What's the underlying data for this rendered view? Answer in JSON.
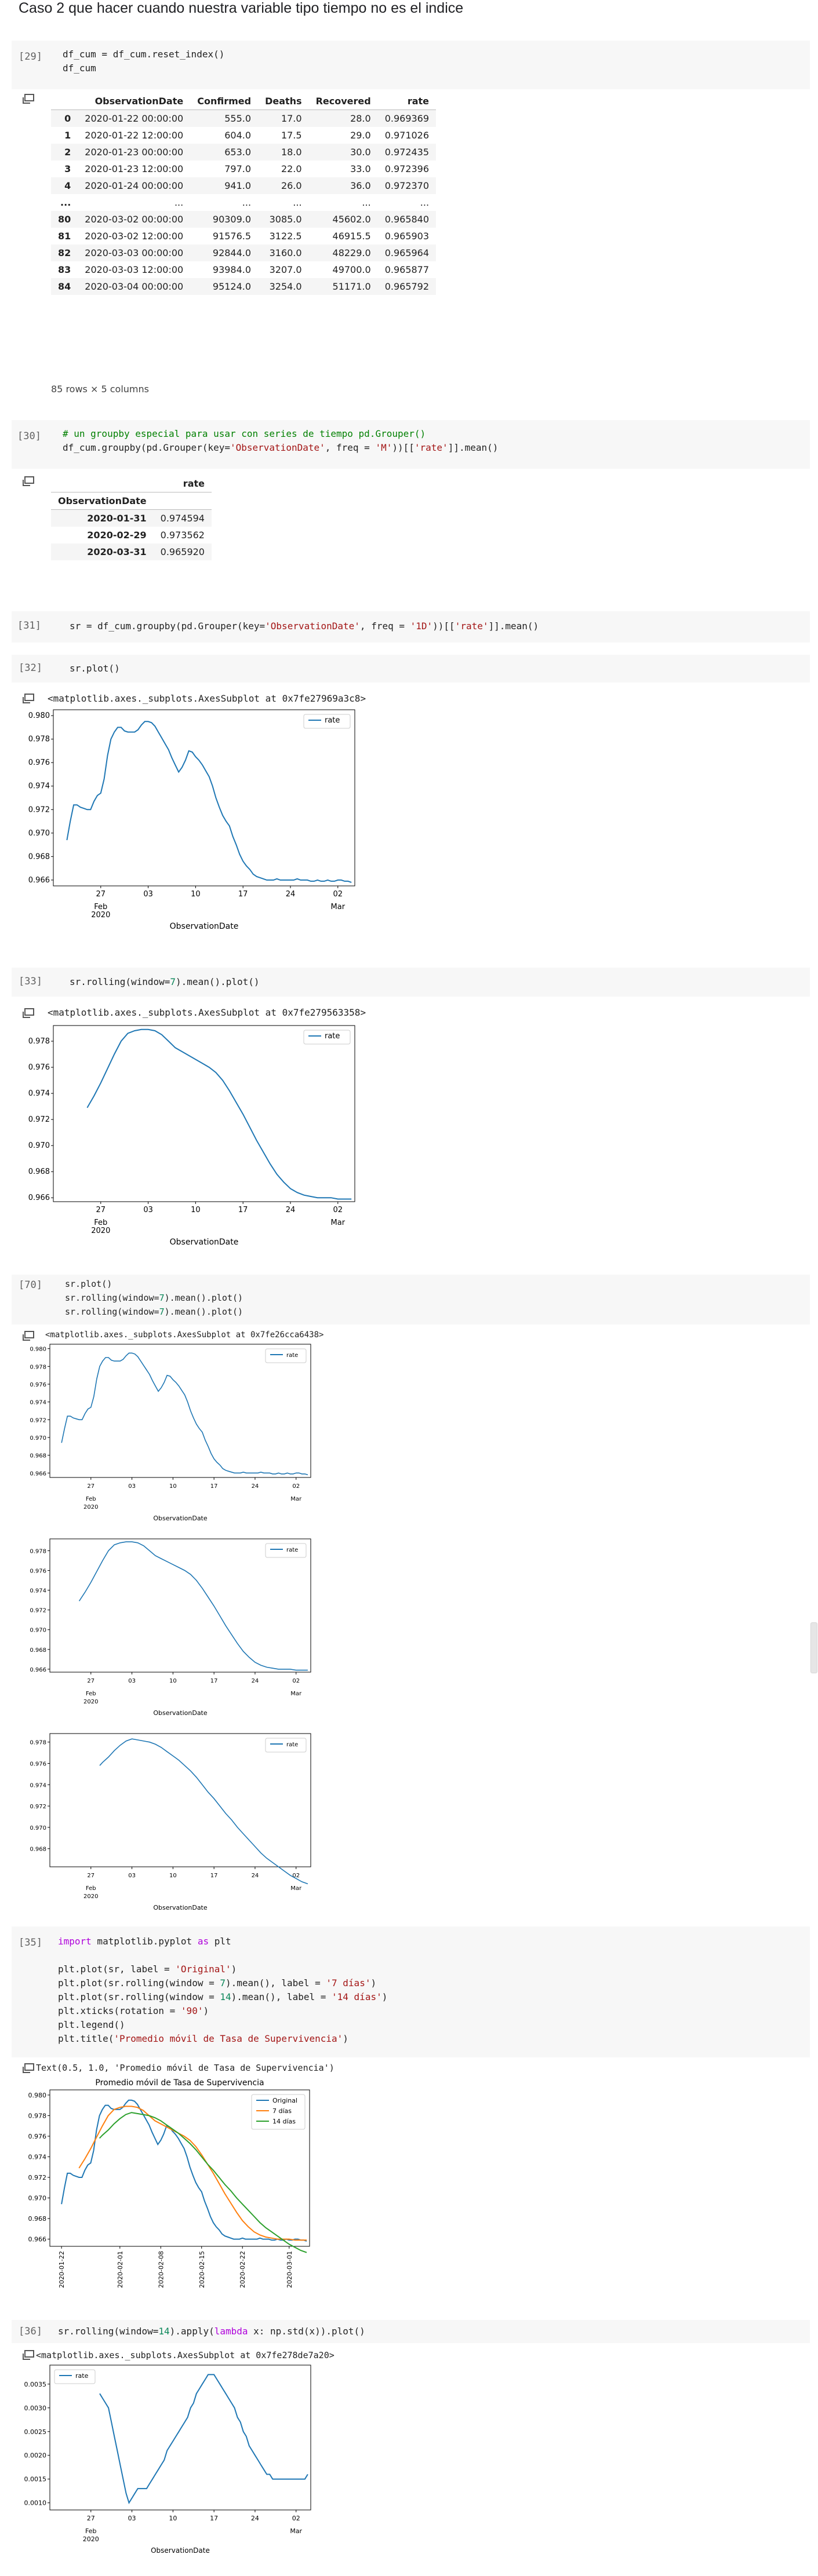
{
  "heading": "Caso 2 que hacer cuando nuestra variable tipo tiempo no es el indice",
  "cells": [
    {
      "prompt": "[29]",
      "code": [
        "df_cum = df_cum.reset_index()",
        "df_cum"
      ]
    },
    {
      "prompt": "[30]",
      "code_comment": "# un groupby especial para usar con series de tiempo pd.Grouper()",
      "code_pre": "df_cum.groupby(pd.Grouper(key=",
      "code_s1": "'ObservationDate'",
      "code_mid": ", freq = ",
      "code_s2": "'M'",
      "code_post": "))[[",
      "code_s3": "'rate'",
      "code_end": "]].mean()"
    },
    {
      "prompt": "[31]",
      "code_pre": "sr = df_cum.groupby(pd.Grouper(key=",
      "code_s1": "'ObservationDate'",
      "code_mid": ", freq = ",
      "code_s2": "'1D'",
      "code_post": "))[[",
      "code_s3": "'rate'",
      "code_end": "]].mean()"
    },
    {
      "prompt": "[32]",
      "code": "sr.plot()",
      "output": "<matplotlib.axes._subplots.AxesSubplot at 0x7fe27969a3c8>"
    },
    {
      "prompt": "[33]",
      "code_pre": "sr.rolling(window=",
      "code_num": "7",
      "code_end": ").mean().plot()",
      "output": "<matplotlib.axes._subplots.AxesSubplot at 0x7fe279563358>"
    },
    {
      "prompt": "[70]",
      "code_l1": "sr.plot()",
      "code_l2_pre": "sr.rolling(window=",
      "code_l2_num": "7",
      "code_l2_end": ").mean().plot()",
      "code_l3_pre": "sr.rolling(window=",
      "code_l3_num": "7",
      "code_l3_end": ").mean().plot()",
      "output": "<matplotlib.axes._subplots.AxesSubplot at 0x7fe26cca6438>"
    },
    {
      "prompt": "[35]",
      "output": "Text(0.5, 1.0, 'Promedio móvil de Tasa de Supervivencia')"
    },
    {
      "prompt": "[36]",
      "code_pre": "sr.rolling(window=",
      "code_num": "14",
      "code_mid": ").apply(",
      "code_kw": "lambda",
      "code_end": " x: np.std(x)).plot()",
      "output": "<matplotlib.axes._subplots.AxesSubplot at 0x7fe278de7a20>"
    }
  ],
  "cell35_lines": {
    "l1_kw1": "import",
    "l1_mid": " matplotlib.pyplot ",
    "l1_kw2": "as",
    "l1_end": " plt",
    "l2_pre": "plt.plot(sr, label = ",
    "l2_s": "'Original'",
    "l2_end": ")",
    "l3_pre": "plt.plot(sr.rolling(window = ",
    "l3_n": "7",
    "l3_mid": ").mean(), label = ",
    "l3_s": "'7 días'",
    "l3_end": ")",
    "l4_pre": "plt.plot(sr.rolling(window = ",
    "l4_n": "14",
    "l4_mid": ").mean(), label = ",
    "l4_s": "'14 días'",
    "l4_end": ")",
    "l5_pre": "plt.xticks(rotation = ",
    "l5_s": "'90'",
    "l5_end": ")",
    "l6": "plt.legend()",
    "l7_pre": "plt.title(",
    "l7_s": "'Promedio móvil de Tasa de Supervivencia'",
    "l7_end": ")"
  },
  "table1": {
    "columns": [
      "",
      "ObservationDate",
      "Confirmed",
      "Deaths",
      "Recovered",
      "rate"
    ],
    "rows": [
      [
        "0",
        "2020-01-22 00:00:00",
        "555.0",
        "17.0",
        "28.0",
        "0.969369"
      ],
      [
        "1",
        "2020-01-22 12:00:00",
        "604.0",
        "17.5",
        "29.0",
        "0.971026"
      ],
      [
        "2",
        "2020-01-23 00:00:00",
        "653.0",
        "18.0",
        "30.0",
        "0.972435"
      ],
      [
        "3",
        "2020-01-23 12:00:00",
        "797.0",
        "22.0",
        "33.0",
        "0.972396"
      ],
      [
        "4",
        "2020-01-24 00:00:00",
        "941.0",
        "26.0",
        "36.0",
        "0.972370"
      ],
      [
        "...",
        "...",
        "...",
        "...",
        "...",
        "..."
      ],
      [
        "80",
        "2020-03-02 00:00:00",
        "90309.0",
        "3085.0",
        "45602.0",
        "0.965840"
      ],
      [
        "81",
        "2020-03-02 12:00:00",
        "91576.5",
        "3122.5",
        "46915.5",
        "0.965903"
      ],
      [
        "82",
        "2020-03-03 00:00:00",
        "92844.0",
        "3160.0",
        "48229.0",
        "0.965964"
      ],
      [
        "83",
        "2020-03-03 12:00:00",
        "93984.0",
        "3207.0",
        "49700.0",
        "0.965877"
      ],
      [
        "84",
        "2020-03-04 00:00:00",
        "95124.0",
        "3254.0",
        "51171.0",
        "0.965792"
      ]
    ],
    "footer": "85 rows × 5 columns"
  },
  "table2": {
    "col": "rate",
    "index_name": "ObservationDate",
    "rows": [
      [
        "2020-01-31",
        "0.974594"
      ],
      [
        "2020-02-29",
        "0.973562"
      ],
      [
        "2020-03-31",
        "0.965920"
      ]
    ]
  },
  "chart_data": [
    {
      "id": "sr_plot",
      "type": "line",
      "xlabel": "ObservationDate",
      "ylabel": "",
      "xticks": [
        "27",
        "03",
        "10",
        "17",
        "24",
        "02"
      ],
      "xticks_sub": [
        "",
        "Feb\n2020",
        "",
        "",
        "",
        "Mar"
      ],
      "ylim": [
        0.9655,
        0.9805
      ],
      "yticks": [
        "0.966",
        "0.968",
        "0.970",
        "0.972",
        "0.974",
        "0.976",
        "0.978",
        "0.980"
      ],
      "series": [
        {
          "name": "rate",
          "color": "#1f77b4",
          "x": [
            0,
            0.5,
            1,
            1.5,
            2,
            2.5,
            3,
            3.5,
            4,
            4.5,
            5,
            5.5,
            6,
            6.5,
            7,
            7.5,
            8,
            8.5,
            9,
            9.5,
            10,
            10.5,
            11,
            11.5,
            12,
            12.5,
            13,
            13.5,
            14,
            14.5,
            15,
            15.5,
            16,
            16.5,
            17,
            17.5,
            18,
            18.5,
            19,
            19.5,
            20,
            20.5,
            21,
            21.5,
            22,
            22.5,
            23,
            23.5,
            24,
            24.5,
            25,
            25.5,
            26,
            26.5,
            27,
            27.5,
            28,
            28.5,
            29,
            29.5,
            30,
            30.5,
            31,
            31.5,
            32,
            32.5,
            33,
            33.5,
            34,
            34.5,
            35,
            35.5,
            36,
            36.5,
            37,
            37.5,
            38,
            38.5,
            39,
            39.5,
            40,
            40.5,
            41,
            41.5,
            42
          ],
          "values": [
            0.9694,
            0.971,
            0.9724,
            0.9724,
            0.9722,
            0.9721,
            0.972,
            0.972,
            0.9727,
            0.9732,
            0.9734,
            0.9746,
            0.9766,
            0.978,
            0.9786,
            0.979,
            0.979,
            0.9787,
            0.9786,
            0.9786,
            0.9786,
            0.9788,
            0.9792,
            0.9795,
            0.9795,
            0.9794,
            0.9791,
            0.9786,
            0.9781,
            0.9776,
            0.9771,
            0.9764,
            0.9758,
            0.9752,
            0.9756,
            0.9762,
            0.977,
            0.9769,
            0.9765,
            0.9762,
            0.9758,
            0.9753,
            0.9748,
            0.974,
            0.973,
            0.9722,
            0.9715,
            0.971,
            0.9706,
            0.9697,
            0.969,
            0.9682,
            0.9676,
            0.9672,
            0.9669,
            0.9665,
            0.9663,
            0.9662,
            0.9661,
            0.966,
            0.966,
            0.966,
            0.9661,
            0.966,
            0.966,
            0.966,
            0.966,
            0.966,
            0.9661,
            0.966,
            0.966,
            0.966,
            0.9659,
            0.9659,
            0.966,
            0.9659,
            0.9659,
            0.966,
            0.9659,
            0.9659,
            0.966,
            0.966,
            0.9659,
            0.9659,
            0.9658
          ]
        }
      ]
    },
    {
      "id": "roll7",
      "type": "line",
      "xlabel": "ObservationDate",
      "ylim": [
        0.9657,
        0.9792
      ],
      "yticks": [
        "0.966",
        "0.968",
        "0.970",
        "0.972",
        "0.974",
        "0.976",
        "0.978"
      ],
      "series": [
        {
          "name": "rate",
          "color": "#1f77b4",
          "x": [
            3,
            4,
            5,
            6,
            7,
            8,
            9,
            10,
            11,
            12,
            13,
            14,
            15,
            16,
            17,
            18,
            19,
            20,
            21,
            22,
            23,
            24,
            25,
            26,
            27,
            28,
            29,
            30,
            31,
            32,
            33,
            34,
            35,
            36,
            37,
            38,
            39,
            40,
            41,
            42
          ],
          "values": [
            0.9729,
            0.9738,
            0.9748,
            0.9759,
            0.977,
            0.978,
            0.9786,
            0.9788,
            0.9789,
            0.9789,
            0.9788,
            0.9785,
            0.978,
            0.9775,
            0.9772,
            0.9769,
            0.9766,
            0.9763,
            0.976,
            0.9756,
            0.975,
            0.9742,
            0.9733,
            0.9724,
            0.9714,
            0.9704,
            0.9695,
            0.9686,
            0.9678,
            0.9672,
            0.9667,
            0.9664,
            0.9662,
            0.9661,
            0.966,
            0.966,
            0.966,
            0.9659,
            0.9659,
            0.9659
          ]
        }
      ]
    },
    {
      "id": "roll7b",
      "type": "line",
      "xlabel": "ObservationDate",
      "ylim": [
        0.9663,
        0.9788
      ],
      "yticks": [
        "0.968",
        "0.970",
        "0.972",
        "0.974",
        "0.976",
        "0.978"
      ],
      "series": [
        {
          "name": "rate",
          "color": "#1f77b4",
          "x": [
            6.5,
            7,
            8,
            9,
            10,
            11,
            12,
            13,
            14,
            15,
            16,
            17,
            18,
            19,
            20,
            21,
            22,
            23,
            24,
            25,
            26,
            27,
            28,
            29,
            30,
            31,
            32,
            33,
            34,
            35,
            36,
            37,
            38,
            39,
            40,
            41,
            42
          ],
          "values": [
            0.9758,
            0.9761,
            0.9766,
            0.9772,
            0.9777,
            0.9781,
            0.9783,
            0.9782,
            0.9781,
            0.978,
            0.9778,
            0.9775,
            0.9771,
            0.9767,
            0.9763,
            0.9758,
            0.9753,
            0.9747,
            0.974,
            0.9733,
            0.9727,
            0.972,
            0.9713,
            0.9707,
            0.97,
            0.9694,
            0.9688,
            0.9682,
            0.9676,
            0.9671,
            0.9667,
            0.9663,
            0.9659,
            0.9655,
            0.9652,
            0.9649,
            0.9647
          ]
        }
      ]
    },
    {
      "id": "multi",
      "type": "line",
      "title": "Promedio móvil de Tasa de Supervivencia",
      "xticks": [
        "2020-01-22",
        "2020-02-01",
        "2020-02-08",
        "2020-02-15",
        "2020-02-22",
        "2020-03-01"
      ],
      "ylim": [
        0.9653,
        0.9805
      ],
      "yticks": [
        "0.966",
        "0.968",
        "0.970",
        "0.972",
        "0.974",
        "0.976",
        "0.978",
        "0.980"
      ],
      "legend": [
        "Original",
        "7 días",
        "14 días"
      ],
      "series": [
        {
          "name": "Original",
          "color": "#1f77b4"
        },
        {
          "name": "7 días",
          "color": "#ff7f0e"
        },
        {
          "name": "14 días",
          "color": "#2ca02c",
          "x": [
            6.5,
            7,
            8,
            9,
            10,
            11,
            12,
            13,
            14,
            15,
            16,
            17,
            18,
            19,
            20,
            21,
            22,
            23,
            24,
            25,
            26,
            27,
            28,
            29,
            30,
            31,
            32,
            33,
            34,
            35,
            36,
            37,
            38,
            39,
            40,
            41,
            42
          ],
          "values": [
            0.9758,
            0.9761,
            0.9766,
            0.9772,
            0.9777,
            0.9781,
            0.9783,
            0.9782,
            0.9781,
            0.978,
            0.9778,
            0.9775,
            0.9771,
            0.9767,
            0.9763,
            0.9758,
            0.9753,
            0.9747,
            0.974,
            0.9733,
            0.9727,
            0.972,
            0.9713,
            0.9707,
            0.97,
            0.9694,
            0.9688,
            0.9682,
            0.9676,
            0.9671,
            0.9667,
            0.9663,
            0.9659,
            0.9655,
            0.9652,
            0.9649,
            0.9647
          ]
        }
      ]
    },
    {
      "id": "std14",
      "type": "line",
      "xlabel": "ObservationDate",
      "ylim": [
        0.00085,
        0.0039
      ],
      "yticks": [
        "0.0010",
        "0.0015",
        "0.0020",
        "0.0025",
        "0.0030",
        "0.0035"
      ],
      "series": [
        {
          "name": "rate",
          "color": "#1f77b4",
          "x": [
            6.5,
            7,
            7.5,
            8,
            8.5,
            9,
            9.5,
            10,
            10.5,
            11,
            11.5,
            12,
            12.5,
            13,
            13.5,
            14,
            14.5,
            15,
            15.5,
            16,
            16.5,
            17,
            17.5,
            18,
            18.5,
            19,
            19.5,
            20,
            20.5,
            21,
            21.5,
            22,
            22.5,
            23,
            23.5,
            24,
            24.5,
            25,
            25.5,
            26,
            26.5,
            27,
            27.5,
            28,
            28.5,
            29,
            29.5,
            30,
            30.5,
            31,
            31.5,
            32,
            32.5,
            33,
            33.5,
            34,
            34.5,
            35,
            35.5,
            36,
            36.5,
            37,
            37.5,
            38,
            38.5,
            39,
            39.5,
            40,
            40.5,
            41,
            41.5,
            42
          ],
          "values": [
            0.0033,
            0.0032,
            0.0031,
            0.003,
            0.0027,
            0.0024,
            0.0021,
            0.0018,
            0.0015,
            0.0012,
            0.001,
            0.0011,
            0.0012,
            0.0013,
            0.0013,
            0.0013,
            0.0013,
            0.0014,
            0.0015,
            0.0016,
            0.0017,
            0.0018,
            0.0019,
            0.0021,
            0.0022,
            0.0023,
            0.0024,
            0.0025,
            0.0026,
            0.0027,
            0.0028,
            0.003,
            0.0031,
            0.0033,
            0.0034,
            0.0035,
            0.0036,
            0.0037,
            0.0037,
            0.0037,
            0.0036,
            0.0035,
            0.0034,
            0.0033,
            0.0032,
            0.0031,
            0.003,
            0.0028,
            0.0027,
            0.0025,
            0.0024,
            0.0022,
            0.0021,
            0.002,
            0.0019,
            0.0018,
            0.0017,
            0.0016,
            0.0016,
            0.0015,
            0.0015,
            0.0015,
            0.0015,
            0.0015,
            0.0015,
            0.0015,
            0.0015,
            0.0015,
            0.0015,
            0.0015,
            0.0015,
            0.0016
          ]
        }
      ]
    }
  ]
}
